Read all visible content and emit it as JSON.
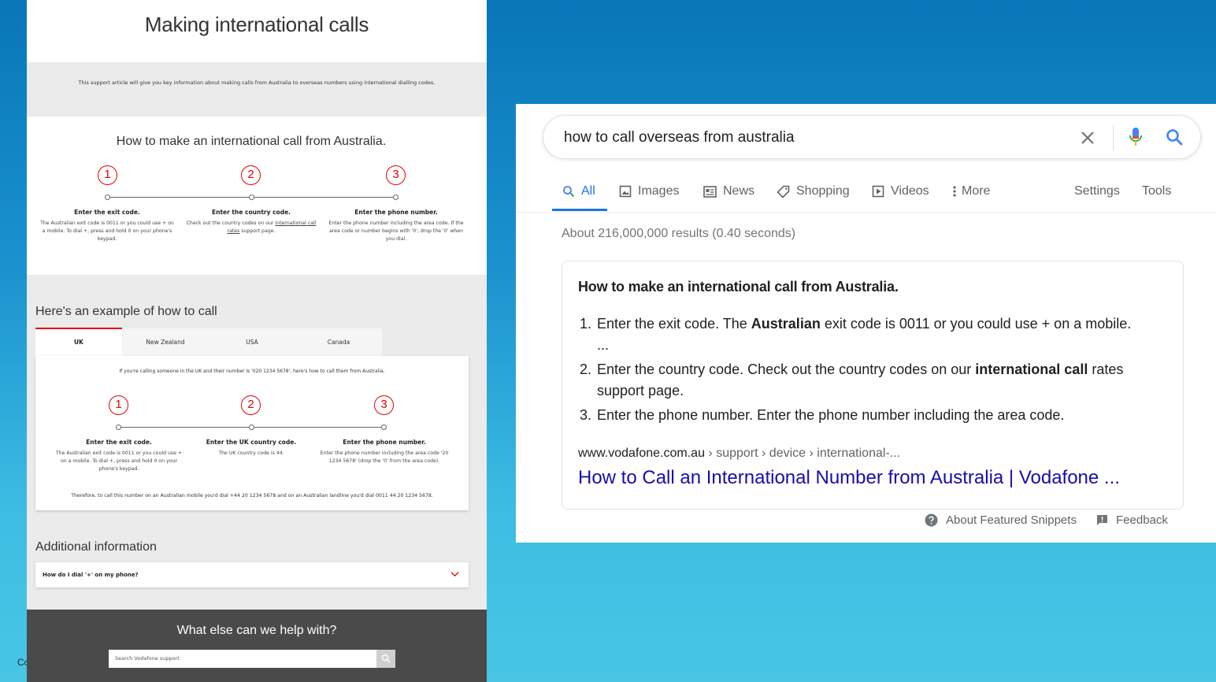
{
  "slide": {
    "corner_text": "Co"
  },
  "vodafone": {
    "title": "Making international calls",
    "intro": "This support article will give you key information about making calls from Australia to overseas numbers using international dialling codes.",
    "how_to_heading": "How to make an international call from Australia.",
    "steps": [
      {
        "number": "1",
        "title": "Enter the exit code.",
        "desc": "The Australian exit code is 0011 or you could use + on a mobile. To dial +, press and hold 0 on your phone's keypad."
      },
      {
        "number": "2",
        "title": "Enter the country code.",
        "desc_before": "Check out the country codes on our ",
        "desc_link": "international call rates",
        "desc_after": " support page."
      },
      {
        "number": "3",
        "title": "Enter the phone number.",
        "desc": "Enter the phone number including the area code. If the area code or number begins with '0', drop the '0' when you dial."
      }
    ],
    "example_heading": "Here's an example of how to call",
    "tabs": [
      "UK",
      "New Zealand",
      "USA",
      "Canada"
    ],
    "active_tab": "UK",
    "example": {
      "intro": "If you're calling someone in the UK and their number is '020 1234 5678', here's how to call them from Australia.",
      "steps": [
        {
          "number": "1",
          "title": "Enter the exit code.",
          "desc": "The Australian exit code is 0011 or you could use + on a mobile. To dial +, press and hold 0 on your phone's keypad."
        },
        {
          "number": "2",
          "title": "Enter the UK country code.",
          "desc": "The UK country code is 44."
        },
        {
          "number": "3",
          "title": "Enter the phone number.",
          "desc": "Enter the phone number including the area code '20 1234 5678' (drop the '0' from the area code)."
        }
      ],
      "therefore": "Therefore, to call this number on an Australian mobile you'd dial +44 20 1234 5678 and on an Australian landline you'd dial 0011 44 20 1234 5678."
    },
    "additional_heading": "Additional information",
    "faq": "How do I dial '+' on my phone?",
    "footer_title": "What else can we help with?",
    "search_placeholder": "Search Vodafone support"
  },
  "google": {
    "query": "how to call overseas from australia",
    "tabs": [
      "All",
      "Images",
      "News",
      "Shopping",
      "Videos",
      "More"
    ],
    "settings": "Settings",
    "tools": "Tools",
    "stats": "About 216,000,000 results (0.40 seconds)",
    "snippet": {
      "title": "How to make an international call from Australia.",
      "items": [
        {
          "n": "1.",
          "a": "Enter the exit code. The ",
          "b": "Australian",
          "c": " exit code is 0011 or you could use + on a mobile. ..."
        },
        {
          "n": "2.",
          "a": "Enter the country code. Check out the country codes on our ",
          "b": "international call",
          "c": " rates support page."
        },
        {
          "n": "3.",
          "a": "Enter the phone number. Enter the phone number including the area code.",
          "b": "",
          "c": ""
        }
      ],
      "domain": "www.vodafone.com.au",
      "breadcrumb": " › support › device › international-...",
      "link": "How to Call an International Number from Australia | Vodafone ..."
    },
    "about_snippets": "About Featured Snippets",
    "feedback": "Feedback"
  },
  "colors": {
    "vodafone_red": "#e60000",
    "google_blue": "#1a73e8",
    "link": "#1a0dab"
  }
}
